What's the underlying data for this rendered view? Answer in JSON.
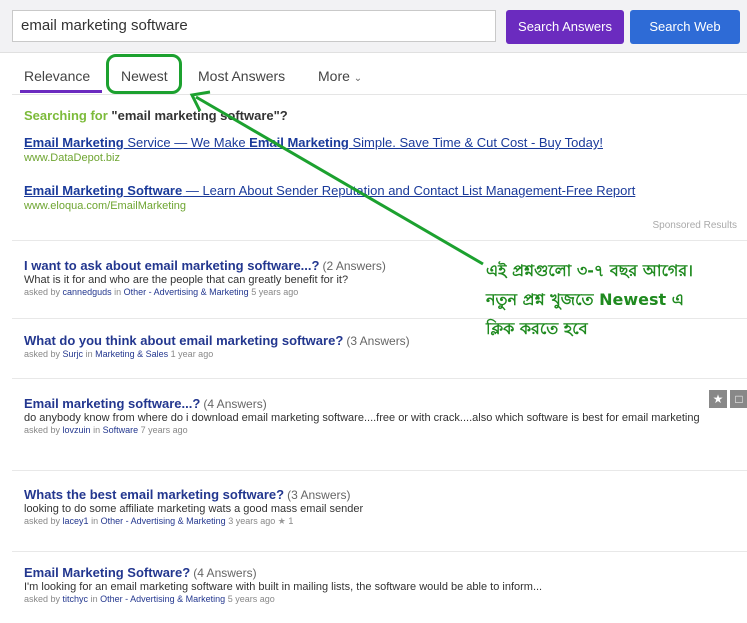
{
  "search": {
    "query": "email marketing software",
    "answers_button": "Search Answers",
    "web_button": "Search Web"
  },
  "tabs": [
    {
      "label": "Relevance"
    },
    {
      "label": "Newest"
    },
    {
      "label": "Most Answers"
    },
    {
      "label": "More"
    }
  ],
  "searching": {
    "prefix": "Searching for",
    "term": "\"email marketing software\"?"
  },
  "ads": [
    {
      "title_bold": "Email Marketing",
      "title_rest": " Service — We Make ",
      "title_bold2": "Email Marketing",
      "title_rest2": " Simple. Save Time & Cut Cost - Buy Today!",
      "url": "www.DataDepot.biz"
    },
    {
      "title_bold": "Email Marketing Software",
      "title_rest": " — Learn About Sender Reputation and Contact List Management-Free Report",
      "url": "www.eloqua.com/EmailMarketing"
    }
  ],
  "sponsored": "Sponsored Results",
  "questions": [
    {
      "title": "I want to ask about email marketing software...?",
      "answers": "(2 Answers)",
      "desc": "What is it for and who are the people that can greatly benefit for it?",
      "asked_by": "asked by",
      "user": "cannedguds",
      "in": "in",
      "category": "Other - Advertising & Marketing",
      "time": "5 years ago"
    },
    {
      "title": "What do you think about email marketing software?",
      "answers": "(3 Answers)",
      "desc": "",
      "asked_by": "asked by",
      "user": "Surjc",
      "in": "in",
      "category": "Marketing & Sales",
      "time": "1 year ago"
    },
    {
      "title": "Email marketing software...?",
      "answers": "(4 Answers)",
      "desc": "do anybody know from where do i download email marketing software....free or with crack....also which software is best for email marketing",
      "asked_by": "asked by",
      "user": "lovzuin",
      "in": "in",
      "category": "Software",
      "time": "7 years ago"
    },
    {
      "title": "Whats the best email marketing software?",
      "answers": "(3 Answers)",
      "desc": "looking to do some affiliate marketing wats a good mass email sender",
      "asked_by": "asked by",
      "user": "lacey1",
      "in": "in",
      "category": "Other - Advertising & Marketing",
      "time": "3 years ago",
      "stars": "1"
    },
    {
      "title": "Email Marketing Software?",
      "answers": "(4 Answers)",
      "desc": "I'm looking for an email marketing software with built in mailing lists, the software would be able to inform...",
      "asked_by": "asked by",
      "user": "titchyc",
      "in": "in",
      "category": "Other - Advertising & Marketing",
      "time": "5 years ago"
    }
  ],
  "annotation": {
    "line1": "এই প্রশ্নগুলো ৩-৭ বছর আগের।",
    "line2": "নতুন প্রশ্ন খুজতে Newest এ",
    "line3": "ক্লিক করতে হবে"
  },
  "colors": {
    "answers_button": "#6b2bbf",
    "web_button": "#2e6bd6",
    "annotation": "#1ca12f",
    "link": "#23378f",
    "url": "#6ea531"
  },
  "icons": [
    "star-icon",
    "comment-icon",
    "chevron-down-icon",
    "small-star-icon"
  ]
}
